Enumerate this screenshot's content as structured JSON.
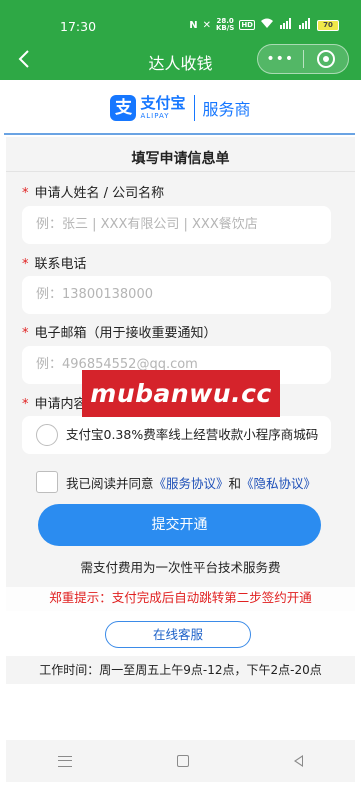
{
  "status_bar": {
    "time": "17:30",
    "speed_value": "28.0",
    "speed_unit": "KB/S",
    "battery": "70"
  },
  "header": {
    "title": "达人收钱",
    "more_label": "•••"
  },
  "brand": {
    "logo_char": "支",
    "name": "支付宝",
    "name_en": "ALIPAY",
    "subtitle": "服务商"
  },
  "form": {
    "title": "填写申请信息单",
    "fields": [
      {
        "label": "申请人姓名 / 公司名称",
        "placeholder": "例：张三 | XXX有限公司 | XXX餐饮店"
      },
      {
        "label": "联系电话",
        "placeholder": "例：13800138000"
      },
      {
        "label": "电子邮箱（用于接收重要通知）",
        "placeholder": "例：496854552@qq.com"
      },
      {
        "label": "申请内容",
        "option": "支付宝0.38%费率线上经营收款小程序商城码"
      }
    ],
    "agree": {
      "prefix": "我已阅读并同意",
      "link1": "《服务协议》",
      "middle": "和",
      "link2": "《隐私协议》"
    },
    "submit_label": "提交开通",
    "fee_note": "需支付费用为一次性平台技术服务费"
  },
  "watermark": "mubanwu.cc",
  "notice": "郑重提示：支付完成后自动跳转第二步签约开通",
  "service_button": "在线客服",
  "work_hours": "工作时间：周一至周五上午9点-12点，下午2点-20点",
  "colors": {
    "header_green": "#2ea845",
    "primary_blue": "#2b8cf0",
    "alert_red": "#e02020"
  }
}
